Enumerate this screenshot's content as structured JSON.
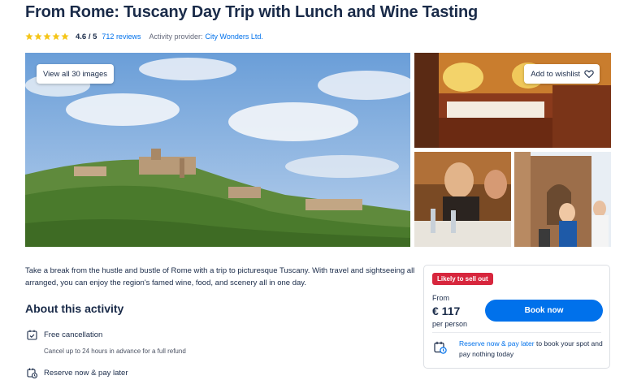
{
  "header": {
    "title": "From Rome: Tuscany Day Trip with Lunch and Wine Tasting",
    "rating": "4.6 / 5",
    "reviews": "712 reviews",
    "provider_label": "Activity provider:",
    "provider": "City Wonders Ltd.",
    "star_color": "#f5c518",
    "star_rating": 4.6
  },
  "gallery": {
    "view_all_label": "View all 30 images",
    "wishlist_label": "Add to wishlist"
  },
  "description": "Take a break from the hustle and bustle of Rome with a trip to picturesque Tuscany. With travel and sightseeing all arranged, you can enjoy the region's famed wine, food, and scenery all in one day.",
  "about": {
    "title": "About this activity",
    "features": [
      {
        "label": "Free cancellation",
        "sub": "Cancel up to 24 hours in advance for a full refund",
        "icon": "calendar-check-icon"
      },
      {
        "label": "Reserve now & pay later",
        "icon": "calendar-clock-icon"
      }
    ]
  },
  "booking": {
    "badge": "Likely to sell out",
    "from_label": "From",
    "price": "€ 117",
    "per_person": "per person",
    "book_label": "Book now",
    "reserve_link": "Reserve now & pay later",
    "reserve_rest": " to book your spot and pay nothing today",
    "accent_color": "#0071eb",
    "badge_color": "#d7263d"
  }
}
